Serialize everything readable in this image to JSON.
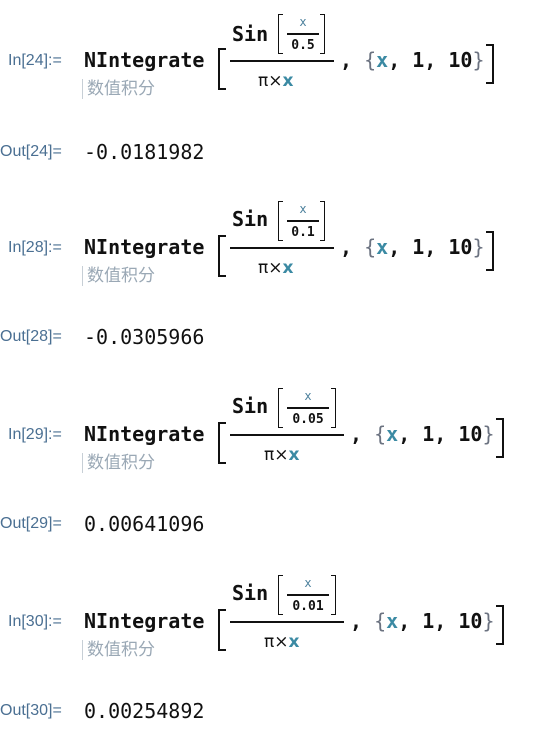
{
  "cells": [
    {
      "in_label": "In[24]:=",
      "function": "NIntegrate",
      "tooltip": "数值积分",
      "numerator_fn": "Sin",
      "inner_numerator": "x",
      "inner_denominator": "0.5",
      "denominator_pi": "π",
      "denominator_times": "×",
      "denominator_var": "x",
      "range_open": "{",
      "range_var": "x",
      "range_rest": ", 1, 10",
      "range_close": "}",
      "comma": ",",
      "out_label": "Out[24]=",
      "out_value": "-0.0181982"
    },
    {
      "in_label": "In[28]:=",
      "function": "NIntegrate",
      "tooltip": "数值积分",
      "numerator_fn": "Sin",
      "inner_numerator": "x",
      "inner_denominator": "0.1",
      "denominator_pi": "π",
      "denominator_times": "×",
      "denominator_var": "x",
      "range_open": "{",
      "range_var": "x",
      "range_rest": ", 1, 10",
      "range_close": "}",
      "comma": ",",
      "out_label": "Out[28]=",
      "out_value": "-0.0305966"
    },
    {
      "in_label": "In[29]:=",
      "function": "NIntegrate",
      "tooltip": "数值积分",
      "numerator_fn": "Sin",
      "inner_numerator": "x",
      "inner_denominator": "0.05",
      "denominator_pi": "π",
      "denominator_times": "×",
      "denominator_var": "x",
      "range_open": "{",
      "range_var": "x",
      "range_rest": ", 1, 10",
      "range_close": "}",
      "comma": ",",
      "out_label": "Out[29]=",
      "out_value": "0.00641096"
    },
    {
      "in_label": "In[30]:=",
      "function": "NIntegrate",
      "tooltip": "数值积分",
      "numerator_fn": "Sin",
      "inner_numerator": "x",
      "inner_denominator": "0.01",
      "denominator_pi": "π",
      "denominator_times": "×",
      "denominator_var": "x",
      "range_open": "{",
      "range_var": "x",
      "range_rest": ", 1, 10",
      "range_close": "}",
      "comma": ",",
      "out_label": "Out[30]=",
      "out_value": "0.00254892"
    }
  ],
  "colors": {
    "label": "#4a6f92",
    "variable": "#3b8aa3",
    "tooltip": "#9aa8b5"
  }
}
